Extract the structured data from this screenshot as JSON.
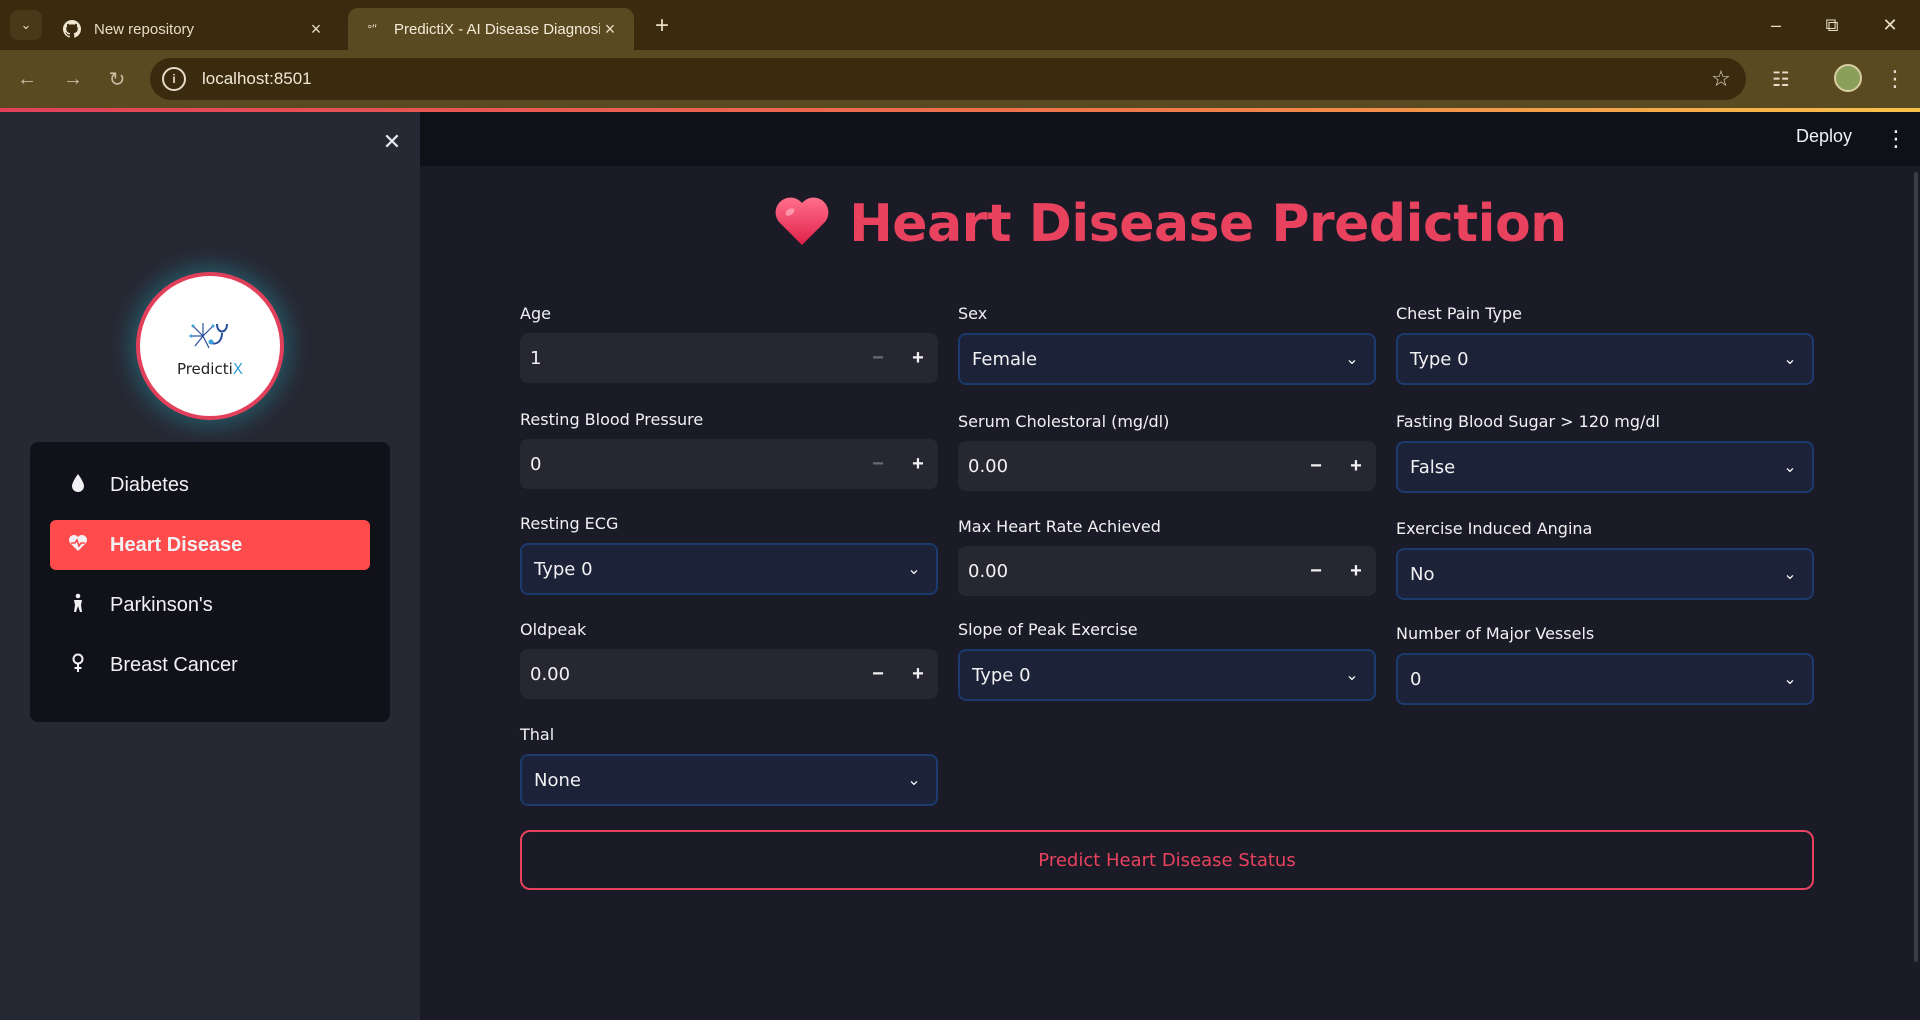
{
  "browser": {
    "tabs": [
      {
        "title": "New repository",
        "icon": "github-icon"
      },
      {
        "title": "PredictiX - AI Disease Diagnosis",
        "icon": "loading-icon"
      }
    ],
    "url": "localhost:8501"
  },
  "header": {
    "deploy_label": "Deploy"
  },
  "sidebar": {
    "logo_text_main": "Predicti",
    "logo_text_accent": "X",
    "items": [
      {
        "label": "Diabetes",
        "icon": "droplet-icon"
      },
      {
        "label": "Heart Disease",
        "icon": "heart-pulse-icon"
      },
      {
        "label": "Parkinson's",
        "icon": "person-icon"
      },
      {
        "label": "Breast Cancer",
        "icon": "female-icon"
      }
    ],
    "active_index": 1
  },
  "main": {
    "title": "Heart Disease Prediction",
    "fields": {
      "age": {
        "label": "Age",
        "value": "1"
      },
      "sex": {
        "label": "Sex",
        "value": "Female"
      },
      "chest_pain": {
        "label": "Chest Pain Type",
        "value": "Type 0"
      },
      "resting_bp": {
        "label": "Resting Blood Pressure",
        "value": "0"
      },
      "cholesterol": {
        "label": "Serum Cholestoral (mg/dl)",
        "value": "0.00"
      },
      "fbs": {
        "label": "Fasting Blood Sugar > 120 mg/dl",
        "value": "False"
      },
      "resting_ecg": {
        "label": "Resting ECG",
        "value": "Type 0"
      },
      "max_hr": {
        "label": "Max Heart Rate Achieved",
        "value": "0.00"
      },
      "exang": {
        "label": "Exercise Induced Angina",
        "value": "No"
      },
      "oldpeak": {
        "label": "Oldpeak",
        "value": "0.00"
      },
      "slope": {
        "label": "Slope of Peak Exercise",
        "value": "Type 0"
      },
      "vessels": {
        "label": "Number of Major Vessels",
        "value": "0"
      },
      "thal": {
        "label": "Thal",
        "value": "None"
      }
    },
    "predict_label": "Predict Heart Disease Status"
  },
  "colors": {
    "accent": "#e8425e",
    "active_menu": "#ff4b4b"
  }
}
